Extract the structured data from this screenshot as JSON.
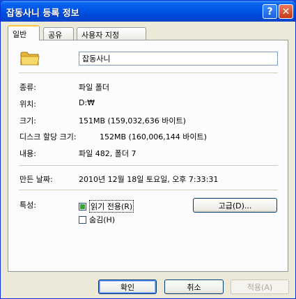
{
  "window": {
    "title": "잡동사니 등록 정보",
    "help_glyph": "?",
    "close_glyph": "✕"
  },
  "tabs": [
    {
      "label": "일반",
      "active": true
    },
    {
      "label": "공유",
      "active": false
    },
    {
      "label": "사용자 지정",
      "active": false
    }
  ],
  "general": {
    "icon": "folder-icon",
    "name_value": "잡동사니",
    "type_label": "종류:",
    "type_value": "파일 폴더",
    "location_label": "위치:",
    "location_value": "D:₩",
    "size_label": "크기:",
    "size_value": "151MB (159,032,636 바이트)",
    "disk_size_label": "디스크 할당 크기:",
    "disk_size_value": "152MB (160,006,144 바이트)",
    "contents_label": "내용:",
    "contents_value": "파일 482, 폴더 7",
    "created_label": "만든 날짜:",
    "created_value": "2010년 12월 18일 토요일, 오후 7:33:31",
    "attributes_label": "특성:",
    "readonly_label": "읽기 전용(R)",
    "readonly_state": "indeterminate",
    "hidden_label": "숨김(H)",
    "hidden_state": "unchecked",
    "advanced_label": "고급(D)..."
  },
  "footer": {
    "ok_label": "확인",
    "cancel_label": "취소",
    "apply_label": "적용(A)"
  },
  "colors": {
    "title_bar": "#0055e5",
    "window_bg": "#ece9d8",
    "panel_bg": "#fcfcfe",
    "tab_highlight": "#ffc83c",
    "close_button": "#c43b16",
    "checkbox_fill": "#2dab2d"
  }
}
